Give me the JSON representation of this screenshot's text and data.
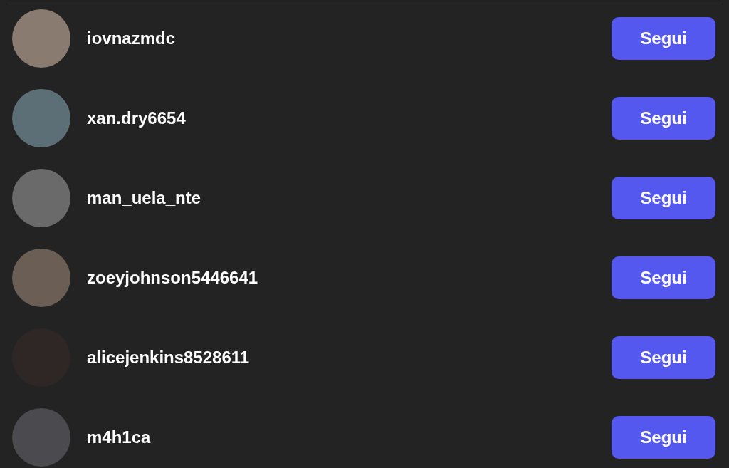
{
  "users": [
    {
      "username": "iovnazmdc",
      "button": "Segui"
    },
    {
      "username": "xan.dry6654",
      "button": "Segui"
    },
    {
      "username": "man_uela_nte",
      "button": "Segui"
    },
    {
      "username": "zoeyjohnson5446641",
      "button": "Segui"
    },
    {
      "username": "alicejenkins8528611",
      "button": "Segui"
    },
    {
      "username": "m4h1ca",
      "button": "Segui"
    }
  ]
}
